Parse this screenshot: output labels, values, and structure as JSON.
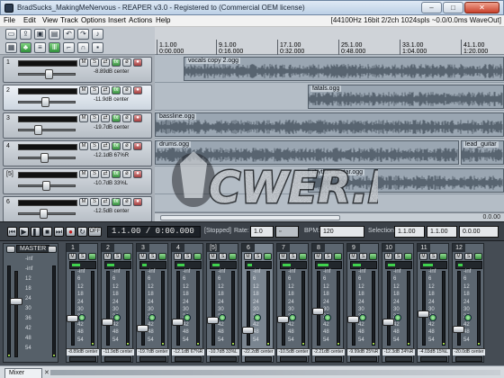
{
  "window": {
    "title": "BradSucks_MakingMeNervous - REAPER v3.0 - Registered to      (Commercial OEM license)",
    "minimize": "–",
    "maximize": "□",
    "close": "✕"
  },
  "menu": {
    "items": [
      "File",
      "Edit",
      "View",
      "Track",
      "Options",
      "Insert",
      "Actions",
      "Help"
    ],
    "status": "[44100Hz 16bit 2/2ch 1024spls ~0.0/0.0ms WaveOut]"
  },
  "toolbar": {
    "icons": [
      "new-project-icon",
      "open-icon",
      "save-icon",
      "project-settings-icon",
      "undo-icon",
      "redo-icon",
      "metronome-icon",
      "lock-icon",
      "grid-icon",
      "snap-icon",
      "ripple-icon",
      "envelope-icon",
      "lock-toggle-icon"
    ]
  },
  "ruler": {
    "marks": [
      {
        "bar": "1.1.00",
        "time": "0:00.000"
      },
      {
        "bar": "9.1.00",
        "time": "0:16.000"
      },
      {
        "bar": "17.1.00",
        "time": "0:32.000"
      },
      {
        "bar": "25.1.00",
        "time": "0:48.000"
      },
      {
        "bar": "33.1.00",
        "time": "1:04.000"
      },
      {
        "bar": "41.1.00",
        "time": "1:20.000"
      }
    ]
  },
  "tracks": [
    {
      "num": "1",
      "vol": "-8.89dB center"
    },
    {
      "num": "2",
      "vol": "-11.9dB center"
    },
    {
      "num": "3",
      "vol": "-19.7dB center"
    },
    {
      "num": "4",
      "vol": "-12.1dB 67%R"
    },
    {
      "num": "[5]",
      "vol": "-10.7dB 33%L"
    },
    {
      "num": "6",
      "vol": "-12.5dB center"
    }
  ],
  "items": [
    {
      "name": "vocals copy 2.ogg"
    },
    {
      "name": "fatals.ogg"
    },
    {
      "name": "bassline.ogg"
    },
    {
      "name": "drums.ogg"
    },
    {
      "name": "lead_guitar"
    },
    {
      "name": "rhythm_guitar.ogg"
    }
  ],
  "arrange": {
    "zoom": "0.0.00"
  },
  "transport": {
    "position": "1.1.00 / 0:00.000",
    "off": "OFF",
    "state": "[Stopped]",
    "rate_label": "Rate:",
    "rate": "1.0",
    "bpm_label": "BPM:",
    "bpm": "120",
    "selection_label": "Selection:",
    "sel_start": "1.1.00",
    "sel_end": "1.1.00",
    "sel_len": "0.0.00"
  },
  "mixer": {
    "master_label": "MASTER",
    "master_scale": [
      "-inf",
      "-inf",
      "12",
      "18",
      "24",
      "30",
      "36",
      "42",
      "48",
      "54"
    ],
    "channel_scale": [
      "-inf",
      "6",
      "12",
      "18",
      "24",
      "30",
      "36",
      "42",
      "48",
      "54"
    ],
    "channels": [
      {
        "num": "1",
        "vol": "-8.89dB center",
        "peak": "-inf",
        "level": 0.35
      },
      {
        "num": "2",
        "vol": "-11.9dB center",
        "peak": "-inf",
        "level": 0.3
      },
      {
        "num": "3",
        "vol": "-19.7dB center",
        "peak": "-inf",
        "level": 0.2
      },
      {
        "num": "4",
        "vol": "-12.1dB 67%R",
        "peak": "-inf",
        "level": 0.3
      },
      {
        "num": "[5]",
        "vol": "-10.7dB 33%L",
        "peak": "-inf",
        "level": 0.32
      },
      {
        "num": "6",
        "vol": "-22.2dB center",
        "peak": "-inf",
        "level": 0.18
      },
      {
        "num": "7",
        "vol": "-10.5dB center",
        "peak": "-inf",
        "level": 0.33
      },
      {
        "num": "8",
        "vol": "-2.21dB center",
        "peak": "-inf",
        "level": 0.45
      },
      {
        "num": "9",
        "vol": "-9.99dB 25%R",
        "peak": "-inf",
        "level": 0.34
      },
      {
        "num": "10",
        "vol": "-12.3dB 24%R",
        "peak": "-inf",
        "level": 0.3
      },
      {
        "num": "11",
        "vol": "-4.03dB 15%L",
        "peak": "-inf",
        "level": 0.42
      },
      {
        "num": "12",
        "vol": "-20.0dB center",
        "peak": "-inf",
        "level": 0.19
      }
    ]
  },
  "mixer_tab": {
    "label": "Mixer",
    "close": "✕"
  },
  "watermark": {
    "text": "CWER.RU"
  }
}
